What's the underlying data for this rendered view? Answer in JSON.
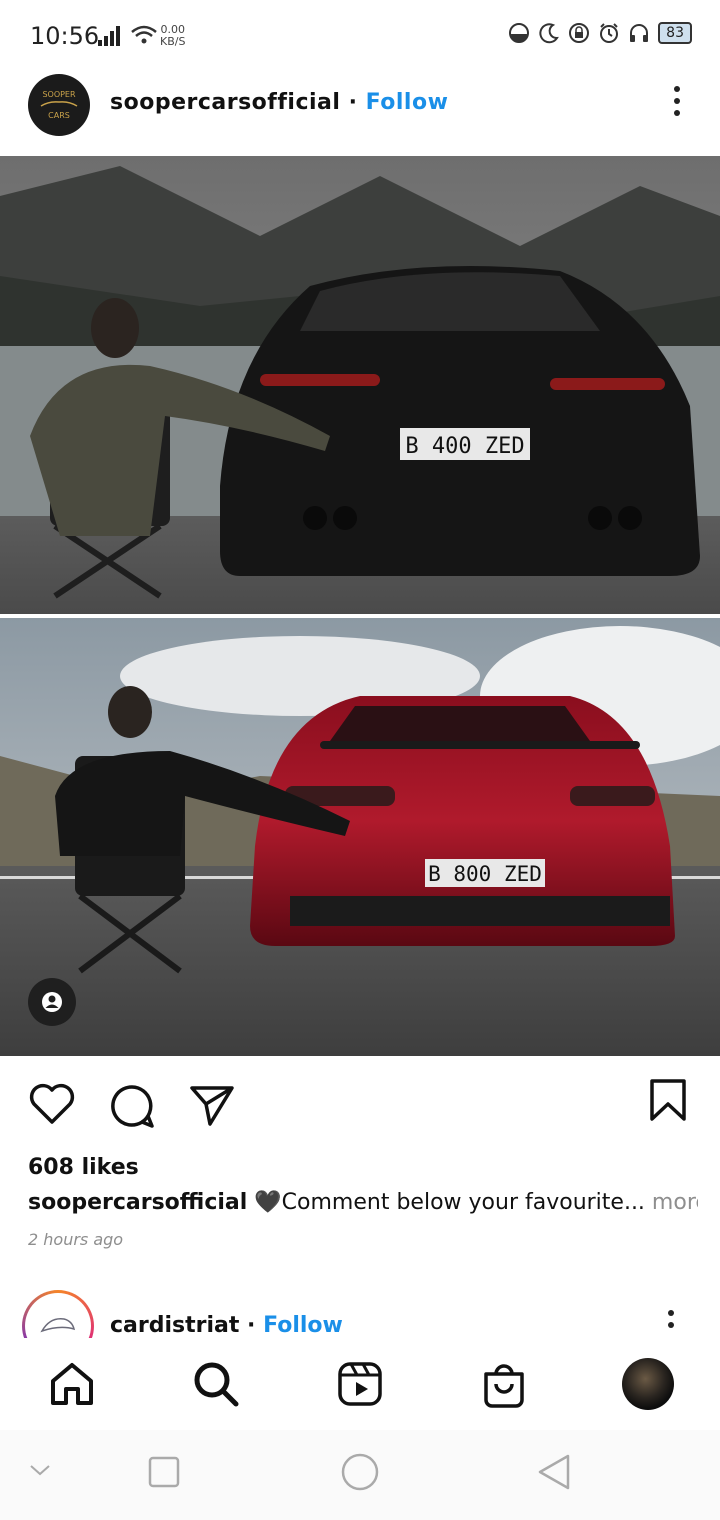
{
  "status_bar": {
    "time": "10:56",
    "net_speed_value": "0.00",
    "net_speed_unit": "KB/S",
    "battery": "83"
  },
  "post": {
    "username": "soopercarsofficial",
    "separator": " · ",
    "follow_label": "Follow",
    "avatar_text_line1": "SOOPER",
    "avatar_text_line2": "CARS",
    "top_plate": "B 400 ZED",
    "bottom_plate": "B 800 ZED",
    "likes": "608 likes",
    "caption_user": "soopercarsofficial",
    "caption_text": " 🖤Comment below your favourite...",
    "caption_more": " more",
    "time_ago": "2 hours ago"
  },
  "next_post": {
    "username": "cardistriat",
    "separator": " · ",
    "follow_label": "Follow"
  },
  "colors": {
    "follow_blue": "#1a8fe8",
    "text": "#111111",
    "muted": "#8e8e8e"
  }
}
